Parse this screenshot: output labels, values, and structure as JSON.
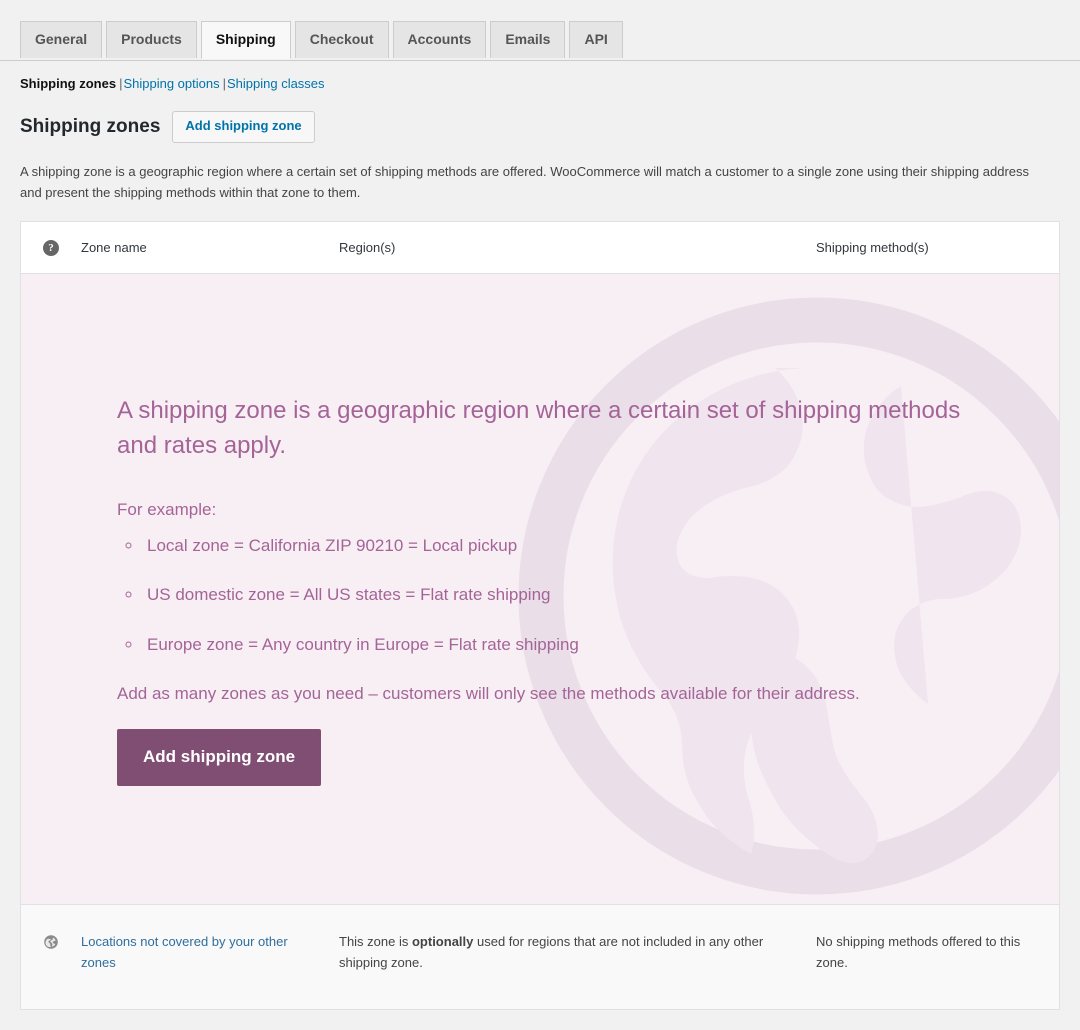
{
  "tabs": [
    {
      "label": "General",
      "active": false
    },
    {
      "label": "Products",
      "active": false
    },
    {
      "label": "Shipping",
      "active": true
    },
    {
      "label": "Checkout",
      "active": false
    },
    {
      "label": "Accounts",
      "active": false
    },
    {
      "label": "Emails",
      "active": false
    },
    {
      "label": "API",
      "active": false
    }
  ],
  "subnav": {
    "items": [
      {
        "label": "Shipping zones",
        "current": true
      },
      {
        "label": "Shipping options",
        "current": false
      },
      {
        "label": "Shipping classes",
        "current": false
      }
    ],
    "separator": "|"
  },
  "header": {
    "title": "Shipping zones",
    "action_label": "Add shipping zone",
    "intro": "A shipping zone is a geographic region where a certain set of shipping methods are offered. WooCommerce will match a customer to a single zone using their shipping address and present the shipping methods within that zone to them."
  },
  "table": {
    "columns": {
      "sort_help_icon": "?",
      "zone_name": "Zone name",
      "regions": "Region(s)",
      "methods": "Shipping method(s)"
    }
  },
  "blank_state": {
    "title": "A shipping zone is a geographic region where a certain set of shipping methods and rates apply.",
    "subtitle": "For example:",
    "examples": [
      "Local zone = California ZIP 90210 = Local pickup",
      "US domestic zone = All US states = Flat rate shipping",
      "Europe zone = Any country in Europe = Flat rate shipping"
    ],
    "outro": "Add as many zones as you need – customers will only see the methods available for their address.",
    "cta_label": "Add shipping zone",
    "watermark_icon": "globe-icon"
  },
  "worldwide_row": {
    "icon": "globe-icon",
    "zone_link": "Locations not covered by your other zones",
    "region_text_before": "This zone is ",
    "region_text_emphasis": "optionally",
    "region_text_after": " used for regions that are not included in any other shipping zone.",
    "methods_text": "No shipping methods offered to this zone."
  },
  "colors": {
    "accent_purple": "#a46497",
    "button_purple": "#7f4e72",
    "blank_bg": "#f8eff5",
    "watermark": "#eadfe8",
    "link_blue": "#0073aa",
    "page_bg": "#f1f1f1"
  }
}
